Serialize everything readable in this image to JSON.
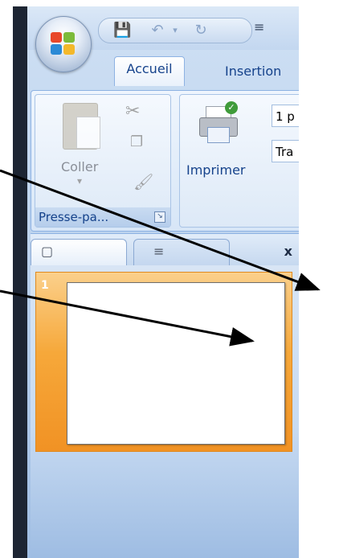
{
  "quick_access": {
    "save_icon": "save-icon",
    "undo_icon": "undo-icon",
    "redo_icon": "redo-icon",
    "customize_icon": "customize-qat-icon"
  },
  "tabs": {
    "home": "Accueil",
    "insert": "Insertion"
  },
  "ribbon": {
    "clipboard": {
      "paste_label": "Coller",
      "group_label": "Presse-pa..."
    },
    "print": {
      "print_label": "Imprimer",
      "field1_value": "1 p",
      "field2_value": "Tra"
    }
  },
  "pane": {
    "close_label": "x",
    "slides": [
      {
        "number": "1"
      }
    ]
  },
  "colors": {
    "selection_orange": "#f6a83a",
    "ribbon_blue": "#dde9f7",
    "tab_text": "#15428b"
  }
}
